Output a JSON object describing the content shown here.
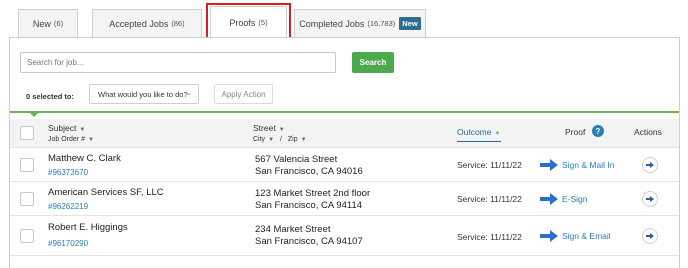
{
  "tabs": [
    {
      "label": "New",
      "count": "(6)"
    },
    {
      "label": "Accepted Jobs",
      "count": "(86)"
    },
    {
      "label": "Proofs",
      "count": "(5)"
    },
    {
      "label": "Completed Jobs",
      "count": "(16,783)",
      "badge": "New"
    }
  ],
  "search": {
    "placeholder": "Search for job...",
    "button": "Search"
  },
  "bulk": {
    "selected": "0 selected to:",
    "select_value": "What would you like to do?",
    "apply": "Apply Action"
  },
  "columns": {
    "subject": "Subject",
    "job_order": "Job Order #",
    "street": "Street",
    "city": "City",
    "slash": "/",
    "zip": "Zip",
    "outcome": "Outcome",
    "proof": "Proof",
    "actions": "Actions"
  },
  "rows": [
    {
      "name": "Matthew C. Clark",
      "job_order": "#96373670",
      "street": "567 Valencia Street",
      "city": "San Francisco, CA 94016",
      "service": "Service: 11/11/22",
      "proof": "Sign & Mail In"
    },
    {
      "name": "American Services SF, LLC",
      "job_order": "#96262219",
      "street": "123 Market Street 2nd floor",
      "city": "San Francisco, CA 94114",
      "service": "Service: 11/11/22",
      "proof": "E-Sign"
    },
    {
      "name": "Robert E. Higgings",
      "job_order": "#96170290",
      "street": "234 Market Street",
      "city": "San Francisco, CA 94107",
      "service": "Service: 11/11/22",
      "proof": "Sign & Email"
    }
  ],
  "colors": {
    "accent_green": "#4caa4c",
    "link_blue": "#2a7eb4",
    "highlight_red": "#d62020",
    "badge_bg": "#2e6e8e"
  },
  "icons": {
    "help": "question-circle-icon",
    "proof": "arrow-right-icon",
    "action": "circle-arrow-right-icon",
    "sort": "caret-down-icon",
    "dropdown": "chevron-down-icon"
  }
}
